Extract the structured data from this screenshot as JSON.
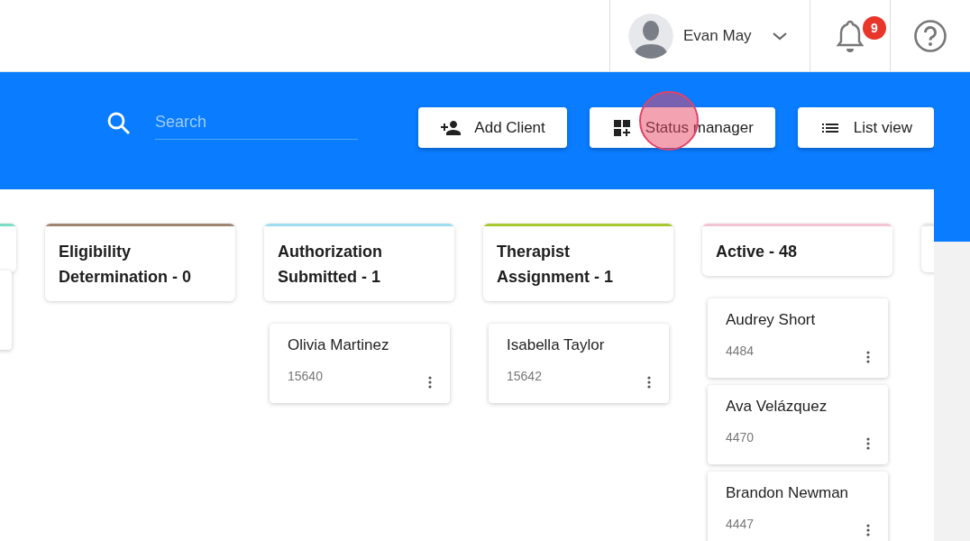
{
  "header": {
    "user": {
      "name": "Evan May"
    },
    "notifications": {
      "count": "9"
    }
  },
  "toolbar": {
    "search": {
      "placeholder": "Search"
    },
    "buttons": [
      {
        "kind": "add-client",
        "label": "Add Client",
        "clicked": false
      },
      {
        "kind": "status-manager",
        "label": "Status manager",
        "clicked": true
      },
      {
        "kind": "list-view",
        "label": "List view",
        "clicked": false
      }
    ]
  },
  "columns": [
    {
      "color": "#7fdcc4",
      "cards": [
        {
          "kind": "clipped"
        }
      ]
    },
    {
      "title": "Eligibility Determination - 0",
      "color": "#a08472"
    },
    {
      "title": "Authorization Submitted - 1",
      "color": "#9fdcf0",
      "cards": [
        {
          "kind": "client",
          "name": "Olivia Martinez",
          "id": "15640"
        }
      ]
    },
    {
      "title": "Therapist Assignment - 1",
      "color": "#a8c832",
      "cards": [
        {
          "kind": "client",
          "name": "Isabella Taylor",
          "id": "15642"
        }
      ]
    },
    {
      "title": "Active - 48",
      "color": "#f2c4d4",
      "cards": [
        {
          "kind": "client",
          "name": "Audrey Short",
          "id": "4484"
        },
        {
          "kind": "client",
          "name": "Ava Velázquez",
          "id": "4470"
        },
        {
          "kind": "client",
          "name": "Brandon Newman",
          "id": "4447"
        }
      ]
    },
    {
      "color": "#e6e6e6"
    }
  ]
}
